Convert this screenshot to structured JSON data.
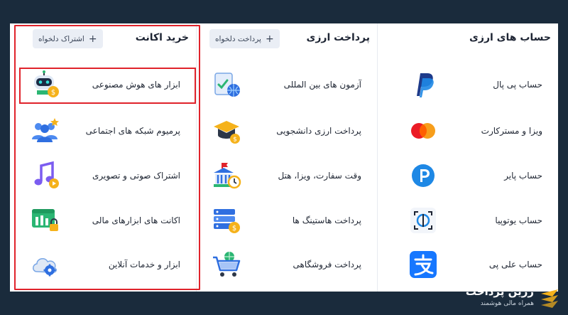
{
  "columns": {
    "currency_accounts": {
      "title": "حساب های ارزی",
      "items": [
        {
          "label": "حساب پی پال",
          "icon": "paypal-icon"
        },
        {
          "label": "ویزا و مسترکارت",
          "icon": "mastercard-icon"
        },
        {
          "label": "حساب پایر",
          "icon": "payoneer-icon"
        },
        {
          "label": "حساب یوتوپیا",
          "icon": "utopia-icon"
        },
        {
          "label": "حساب علی پی",
          "icon": "alipay-icon"
        }
      ]
    },
    "currency_payment": {
      "title": "پرداخت ارزی",
      "chip": "پرداخت دلخواه",
      "items": [
        {
          "label": "آزمون های بین المللی",
          "icon": "exam-globe-icon"
        },
        {
          "label": "پرداخت ارزی دانشجویی",
          "icon": "graduation-cap-icon"
        },
        {
          "label": "وقت سفارت، ویزا، هتل",
          "icon": "embassy-icon"
        },
        {
          "label": "پرداخت هاستینگ ها",
          "icon": "server-icon"
        },
        {
          "label": "پرداخت فروشگاهی",
          "icon": "shopping-cart-icon"
        }
      ]
    },
    "buy_account": {
      "title": "خرید اکانت",
      "chip": "اشتراک دلخواه",
      "items": [
        {
          "label": "ابزار های هوش مصنوعی",
          "icon": "ai-robot-icon"
        },
        {
          "label": "پرمیوم شبکه های اجتماعی",
          "icon": "social-users-icon"
        },
        {
          "label": "اشتراک صوتی و تصویری",
          "icon": "music-note-icon"
        },
        {
          "label": "اکانت های ابزارهای مالی",
          "icon": "finance-lock-icon"
        },
        {
          "label": "ابزار و خدمات آنلاین",
          "icon": "cloud-gear-icon"
        }
      ]
    }
  },
  "brand": {
    "name": "زرین پرداخت",
    "tagline": "همراه مالی هوشمند"
  },
  "colors": {
    "background": "#1a2b3c",
    "highlight": "#e0232b",
    "chip_bg": "#eaeef5",
    "accent_blue": "#2f6fe0"
  }
}
